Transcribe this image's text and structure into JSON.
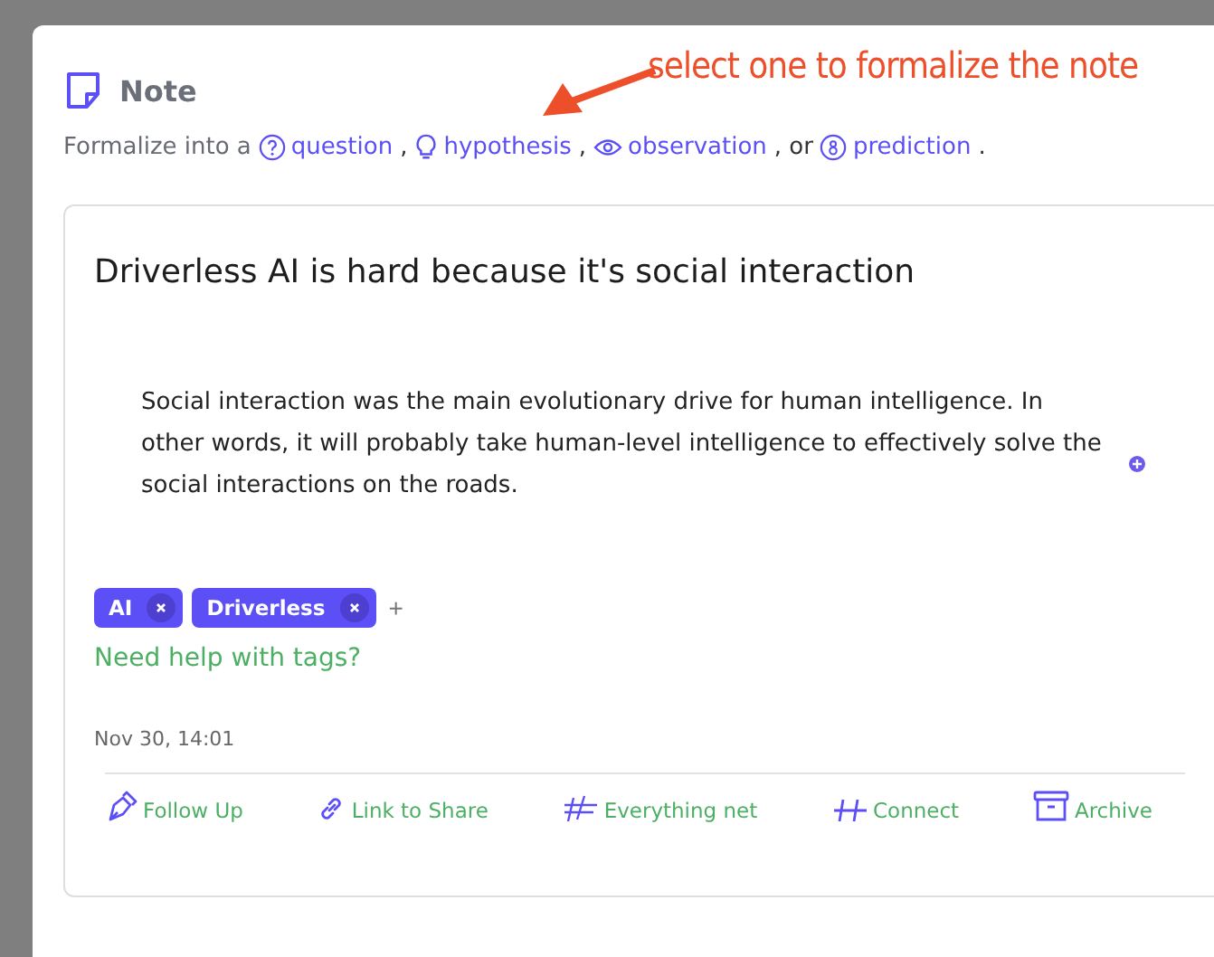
{
  "modal": {
    "title": "Note",
    "formalize_prefix": "Formalize into a",
    "options": [
      {
        "kind": "question",
        "label": "question",
        "sep": ","
      },
      {
        "kind": "hypothesis",
        "label": "hypothesis",
        "sep": ","
      },
      {
        "kind": "observation",
        "label": "observation",
        "sep": ", or"
      },
      {
        "kind": "prediction",
        "label": "prediction",
        "sep": "."
      }
    ]
  },
  "annotation": "select one to formalize the note",
  "note": {
    "title": "Driverless AI is hard because it's social interaction",
    "body": "Social interaction was the main evolutionary drive for human intelligence. In other words, it will probably take human-level intelligence to effectively solve the social interactions on the roads.",
    "tags": [
      "AI",
      "Driverless"
    ],
    "add_tag": "+",
    "help_link": "Need help with tags?",
    "timestamp": "Nov 30, 14:01",
    "actions": [
      {
        "kind": "follow",
        "label": "Follow Up"
      },
      {
        "kind": "link",
        "label": "Link to Share"
      },
      {
        "kind": "everything",
        "label": "Everything net"
      },
      {
        "kind": "connect",
        "label": "Connect"
      },
      {
        "kind": "archive",
        "label": "Archive"
      }
    ]
  }
}
